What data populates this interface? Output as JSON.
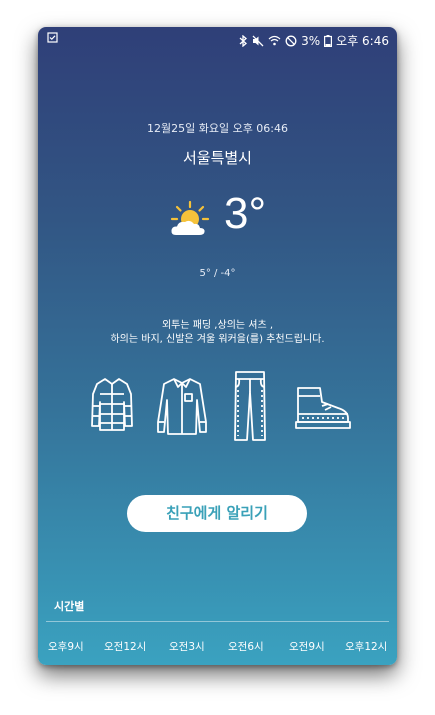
{
  "status_bar": {
    "battery_percent": "3%",
    "time": "오후 6:46",
    "icons": [
      "checkbox-icon",
      "bluetooth-icon",
      "mute-icon",
      "wifi-icon",
      "no-sim-icon",
      "battery-icon"
    ]
  },
  "weather": {
    "date_text": "12월25일 화요일 오후 06:46",
    "city": "서울특별시",
    "condition_icon": "partly-cloudy-icon",
    "temperature": "3°",
    "range": "5° / -4°"
  },
  "recommendation": {
    "line1": "외투는 패딩 ,상의는 셔츠 ,",
    "line2": "하의는 바지, 신발은 겨울 워커을(를) 추천드립니다.",
    "items": [
      "padded-jacket-icon",
      "shirt-icon",
      "pants-icon",
      "winter-boots-icon"
    ]
  },
  "share_button": {
    "label": "친구에게 알리기"
  },
  "hourly": {
    "title": "시간별",
    "times": [
      "오후9시",
      "오전12시",
      "오전3시",
      "오전6시",
      "오전9시",
      "오후12시"
    ]
  },
  "colors": {
    "gradient_top": "#2f3f78",
    "gradient_bottom": "#3aa2c0",
    "button_text": "#3aa1b8",
    "sun": "#f5c23a"
  }
}
